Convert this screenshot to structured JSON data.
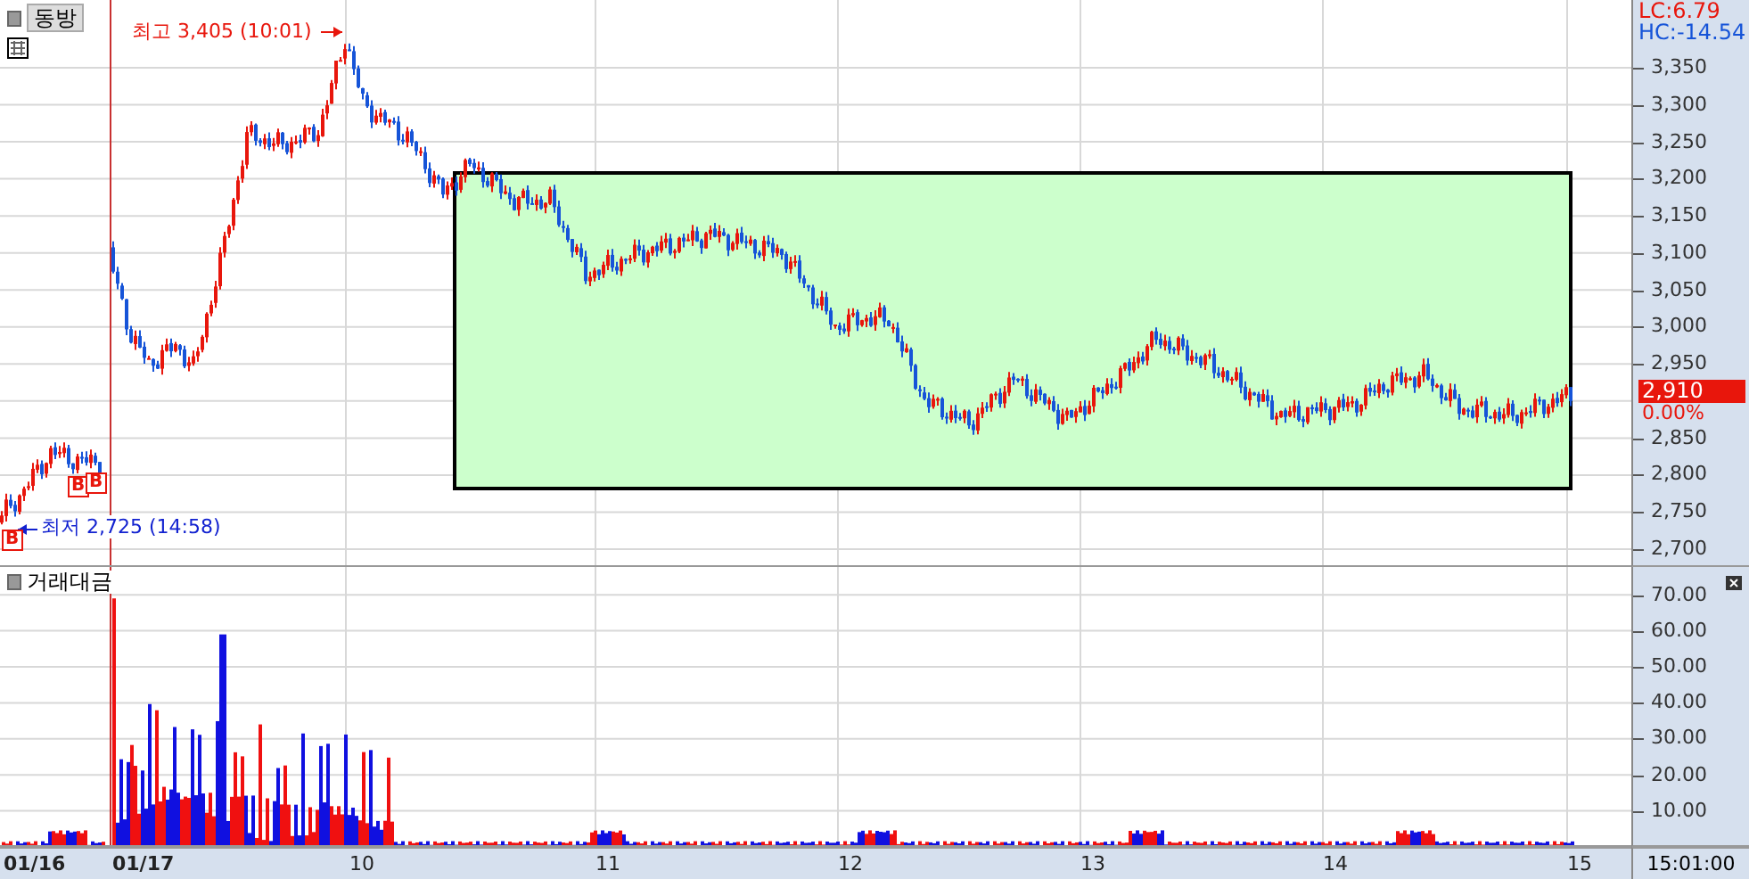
{
  "stock": {
    "name": "동방"
  },
  "price_panel": {
    "high_note": "최고 3,405 (10:01)",
    "low_note": "최저 2,725 (14:58)",
    "signals": [
      {
        "label": "B"
      },
      {
        "label": "B"
      },
      {
        "label": "B"
      }
    ],
    "indicators": [
      {
        "label": "LC:6.79",
        "color": "#e8160c"
      },
      {
        "label": "HC:-14.54",
        "color": "#1654d8"
      }
    ],
    "yticks": [
      "3,350",
      "3,300",
      "3,250",
      "3,200",
      "3,150",
      "3,100",
      "3,050",
      "3,000",
      "2,950",
      "2,850",
      "2,800",
      "2,750",
      "2,700"
    ],
    "last_price": "2,910",
    "change": "0.00%"
  },
  "volume_panel": {
    "title": "거래대금",
    "yticks": [
      "70.00",
      "60.00",
      "50.00",
      "40.00",
      "30.00",
      "20.00",
      "10.00"
    ]
  },
  "time_axis": {
    "labels": [
      {
        "label": "01/16",
        "kind": "date"
      },
      {
        "label": "01/17",
        "kind": "date"
      },
      {
        "label": "10",
        "kind": "hour"
      },
      {
        "label": "11",
        "kind": "hour"
      },
      {
        "label": "12",
        "kind": "hour"
      },
      {
        "label": "13",
        "kind": "hour"
      },
      {
        "label": "14",
        "kind": "hour"
      },
      {
        "label": "15",
        "kind": "hour"
      }
    ],
    "time": "15:01:00"
  }
}
